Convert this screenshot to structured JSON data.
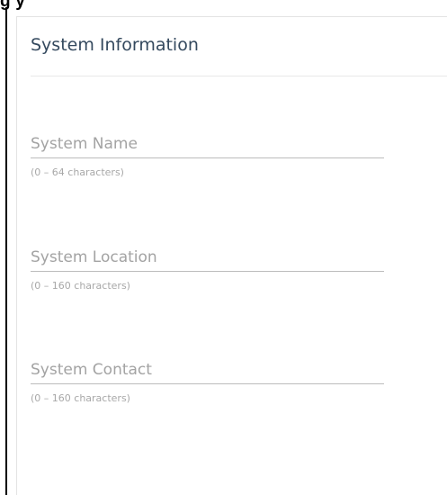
{
  "header": {
    "label_fragment": "g          y"
  },
  "card": {
    "title": "System Information"
  },
  "fields": [
    {
      "label": "System Name",
      "hint": "(0 – 64 characters)",
      "value": ""
    },
    {
      "label": "System Location",
      "hint": "(0 – 160 characters)",
      "value": ""
    },
    {
      "label": "System Contact",
      "hint": "(0 – 160 characters)",
      "value": ""
    }
  ]
}
